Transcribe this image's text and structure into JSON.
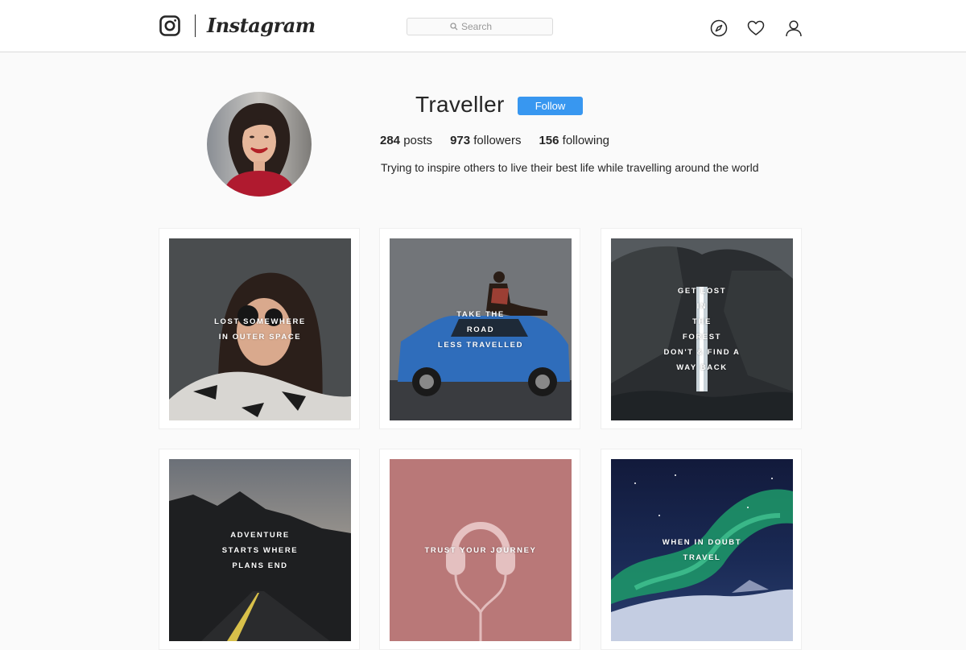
{
  "header": {
    "wordmark": "Instagram",
    "search_placeholder": "Search",
    "icons": [
      "instagram-glyph-icon",
      "search-icon",
      "compass-icon",
      "heart-icon",
      "user-icon"
    ]
  },
  "profile": {
    "username": "Traveller",
    "follow_label": "Follow",
    "stats": {
      "posts_count": "284",
      "posts_label": "posts",
      "followers_count": "973",
      "followers_label": "followers",
      "following_count": "156",
      "following_label": "following"
    },
    "bio": "Trying to inspire others to live their best life while travelling around the world"
  },
  "posts": [
    {
      "lines": [
        "LOST SOMEWHERE",
        "IN OUTER SPACE"
      ]
    },
    {
      "lines": [
        "TAKE THE",
        "ROAD",
        "LESS TRAVELLED"
      ]
    },
    {
      "lines": [
        "GET LOST",
        "IN",
        "THE",
        "FOREST",
        "DON'T & FIND A",
        "WAY BACK"
      ]
    },
    {
      "lines": [
        "ADVENTURE",
        "STARTS WHERE",
        "PLANS END"
      ]
    },
    {
      "lines": [
        "TRUST YOUR JOURNEY"
      ]
    },
    {
      "lines": [
        "WHEN IN DOUBT",
        "TRAVEL"
      ]
    }
  ],
  "colors": {
    "accent": "#3897f0",
    "background": "#fafafa",
    "border": "#dbdbdb"
  }
}
